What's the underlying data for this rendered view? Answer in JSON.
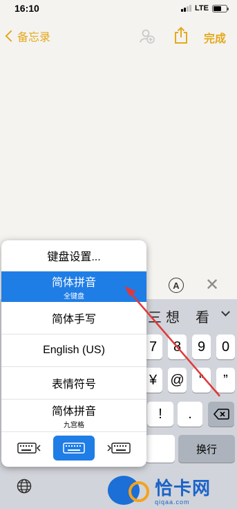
{
  "status": {
    "time": "16:10",
    "network": "LTE"
  },
  "nav": {
    "back_label": "备忘录",
    "done_label": "完成"
  },
  "toolbar": {
    "markup_glyph": "A"
  },
  "candidates": [
    "三",
    "想",
    "看"
  ],
  "popup": {
    "items": [
      {
        "main": "键盘设置...",
        "sub": ""
      },
      {
        "main": "简体拼音",
        "sub": "全键盘",
        "selected": true
      },
      {
        "main": "简体手写",
        "sub": ""
      },
      {
        "main": "English (US)",
        "sub": ""
      },
      {
        "main": "表情符号",
        "sub": ""
      },
      {
        "main": "简体拼音",
        "sub": "九宫格"
      }
    ]
  },
  "keys": {
    "row1": [
      "7",
      "8",
      "9",
      "0"
    ],
    "row2": [
      "¥",
      "@",
      "“",
      "”"
    ],
    "row3": [
      "!",
      "."
    ],
    "return_label": "换行"
  },
  "watermark": {
    "title": "恰卡网",
    "sub": "qiqaa.com"
  },
  "colors": {
    "accent": "#e4a91b",
    "selection": "#1f7de6",
    "arrow": "#e0383a"
  }
}
